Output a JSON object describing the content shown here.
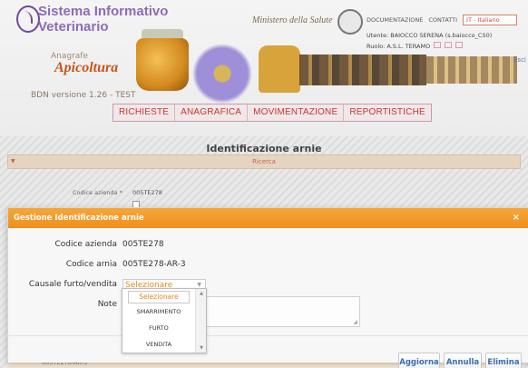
{
  "header": {
    "app_title_line1": "Sistema Informativo",
    "app_title_line2": "Veterinario",
    "app_sub_label": "Anagrafe",
    "app_sub": "Apicoltura",
    "version": "BDN versione 1.26 - TEST",
    "ministry_text": "Ministero della Salute",
    "top_links": [
      "DOCUMENTAZIONE",
      "CONTATTI"
    ],
    "language_selected": "IT - Italiano",
    "user_line": "Utente: BAIOCCO SERENA (s.baiocco_CS0)",
    "role_line": "Ruolo: A.S.L. TERAMO",
    "exit_label": "Esci"
  },
  "nav": {
    "items": [
      "RICHIESTE",
      "ANAGRAFICA",
      "MOVIMENTAZIONE",
      "REPORTISTICHE"
    ]
  },
  "page": {
    "title": "Identificazione arnie",
    "ricerca_label": "Ricerca",
    "codice_azienda_label": "Codice azienda *",
    "codice_azienda_value": "005TE278",
    "row_value": "005TE278-AR-3"
  },
  "modal": {
    "title": "Gestione Identificazione arnie",
    "close_icon": "close-icon",
    "fields": {
      "codice_azienda_label": "Codice azienda",
      "codice_azienda_value": "005TE278",
      "codice_arnia_label": "Codice arnia",
      "codice_arnia_value": "005TE278-AR-3",
      "causale_label": "Causale furto/vendita",
      "causale_selected": "Selezionare",
      "note_label": "Note"
    },
    "dropdown_options": [
      "Selezionare",
      "SMARRIMENTO",
      "FURTO",
      "VENDITA"
    ],
    "buttons": {
      "aggiorna": "Aggiorna",
      "annulla": "Annulla",
      "elimina": "Elimina"
    }
  },
  "colors": {
    "accent_orange": "#ee8f1c",
    "nav_red": "#cc3333",
    "title_purple": "#7b55ad",
    "button_blue": "#3b6fb0"
  }
}
